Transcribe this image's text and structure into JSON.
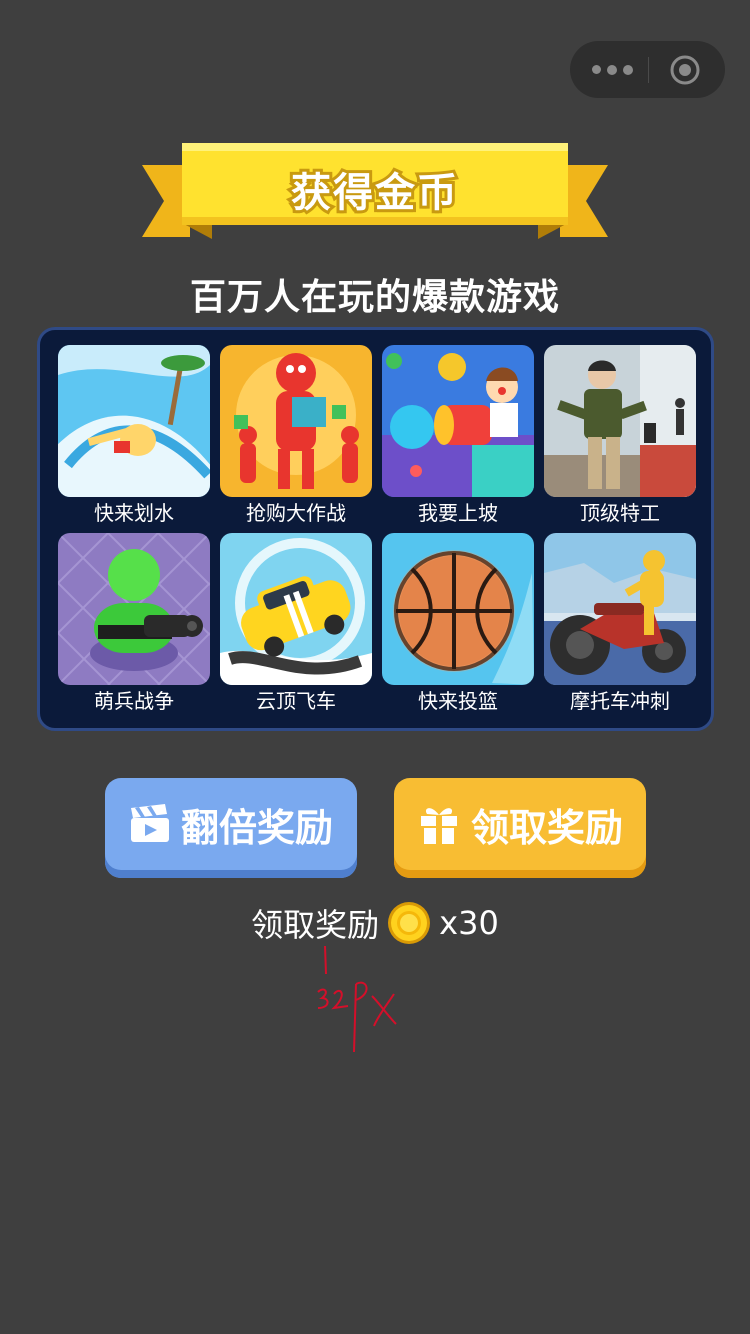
{
  "capsule": {
    "menu_icon": "more-dots-icon",
    "close_icon": "target-circle-icon"
  },
  "header": {
    "title": "获得金币",
    "subtitle": "百万人在玩的爆款游戏"
  },
  "games": [
    {
      "name": "快来划水",
      "icon": "water-slide-icon",
      "color": "#5ec6f2"
    },
    {
      "name": "抢购大作战",
      "icon": "crowd-rush-icon",
      "color": "#f7b52e"
    },
    {
      "name": "我要上坡",
      "icon": "ball-cannon-icon",
      "color": "#3a7be0"
    },
    {
      "name": "顶级特工",
      "icon": "agent-icon",
      "color": "#c8d3d9"
    },
    {
      "name": "萌兵战争",
      "icon": "green-tank-icon",
      "color": "#8e7bc2"
    },
    {
      "name": "云顶飞车",
      "icon": "yellow-car-icon",
      "color": "#7fd4f0"
    },
    {
      "name": "快来投篮",
      "icon": "basketball-icon",
      "color": "#55c5ef"
    },
    {
      "name": "摩托车冲刺",
      "icon": "motorbike-icon",
      "color": "#8fc6e8"
    }
  ],
  "buttons": {
    "double_label": "翻倍奖励",
    "double_icon": "video-clapper-icon",
    "claim_label": "领取奖励",
    "claim_icon": "gift-icon"
  },
  "reward": {
    "label": "领取奖励",
    "coin_icon": "gold-coin-icon",
    "amount": "x30"
  },
  "annotation": {
    "text": "32px"
  }
}
